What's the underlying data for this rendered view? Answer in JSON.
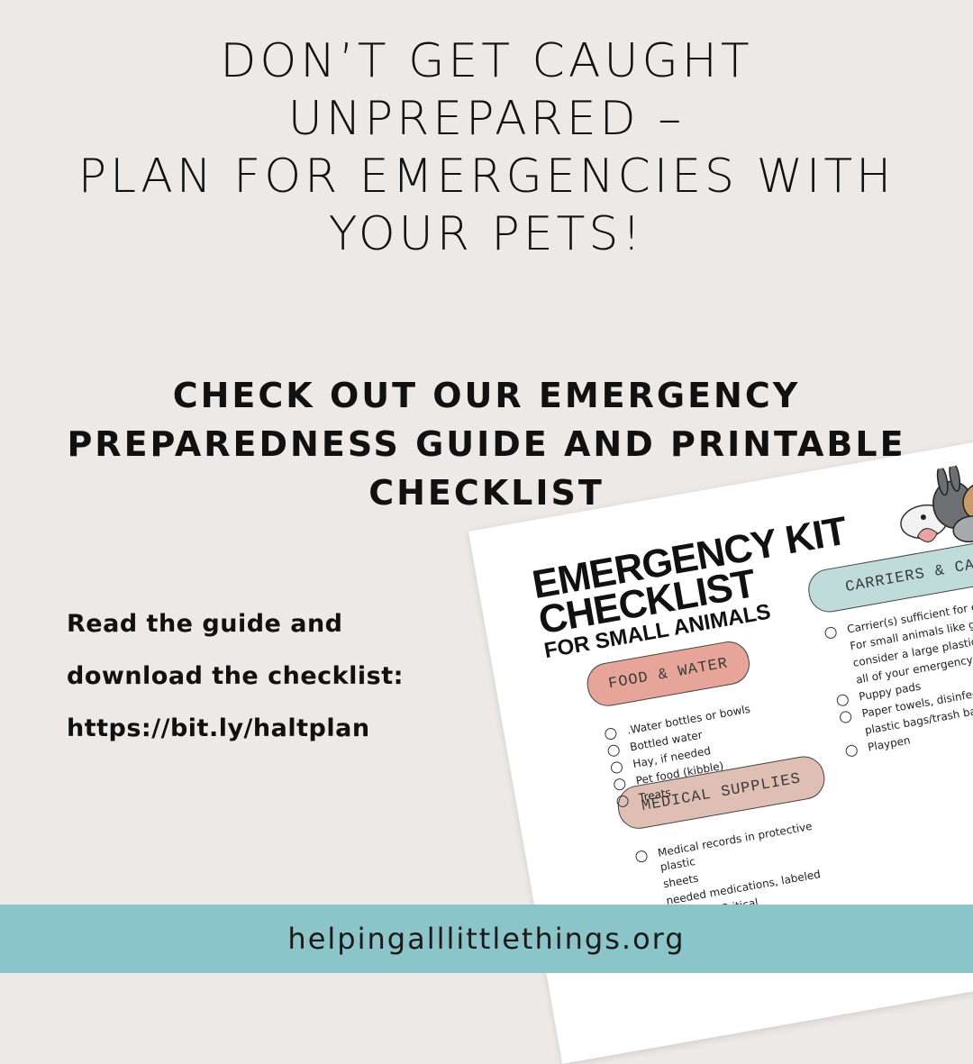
{
  "headline": [
    "DON’T GET CAUGHT",
    "UNPREPARED –",
    "PLAN FOR EMERGENCIES WITH",
    "YOUR PETS!"
  ],
  "subhead": [
    "CHECK OUT OUR EMERGENCY",
    "PREPAREDNESS GUIDE AND PRINTABLE",
    "CHECKLIST"
  ],
  "cta": {
    "line1": "Read the guide and",
    "line2": "download the checklist:",
    "link": "https://bit.ly/haltplan"
  },
  "checklist": {
    "title_line1": "EMERGENCY KIT",
    "title_line2": "CHECKLIST",
    "title_line3": "FOR SMALL ANIMALS",
    "sections": {
      "food": {
        "label": "FOOD & WATER",
        "items": [
          ".Water bottles or bowls",
          "Bottled water",
          "Hay, if needed",
          "Pet food (kibble)",
          "Treats"
        ]
      },
      "cages": {
        "label": "CARRIERS & CAGES",
        "items": [
          "Carrier(s) sufficient for each anima",
          "For small animals like guinea pigs,",
          "consider a large plastic bin and s",
          "all of your emergency supplies i",
          "Puppy pads",
          "Paper towels, disinfectant spr",
          "plastic bags/trash bags",
          "Playpen"
        ]
      },
      "medical": {
        "label": "MEDICAL SUPPLIES",
        "items": [
          "Medical records in protective plastic",
          "sheets",
          "needed medications, labeled",
          "syringes, Critical"
        ]
      }
    },
    "colors": {
      "food": "#e6a598",
      "cages": "#bfdcdb",
      "medical": "#dfbfb3"
    }
  },
  "footer": {
    "url": "helpingalllittlethings.org",
    "color": "#8cc5c9"
  }
}
